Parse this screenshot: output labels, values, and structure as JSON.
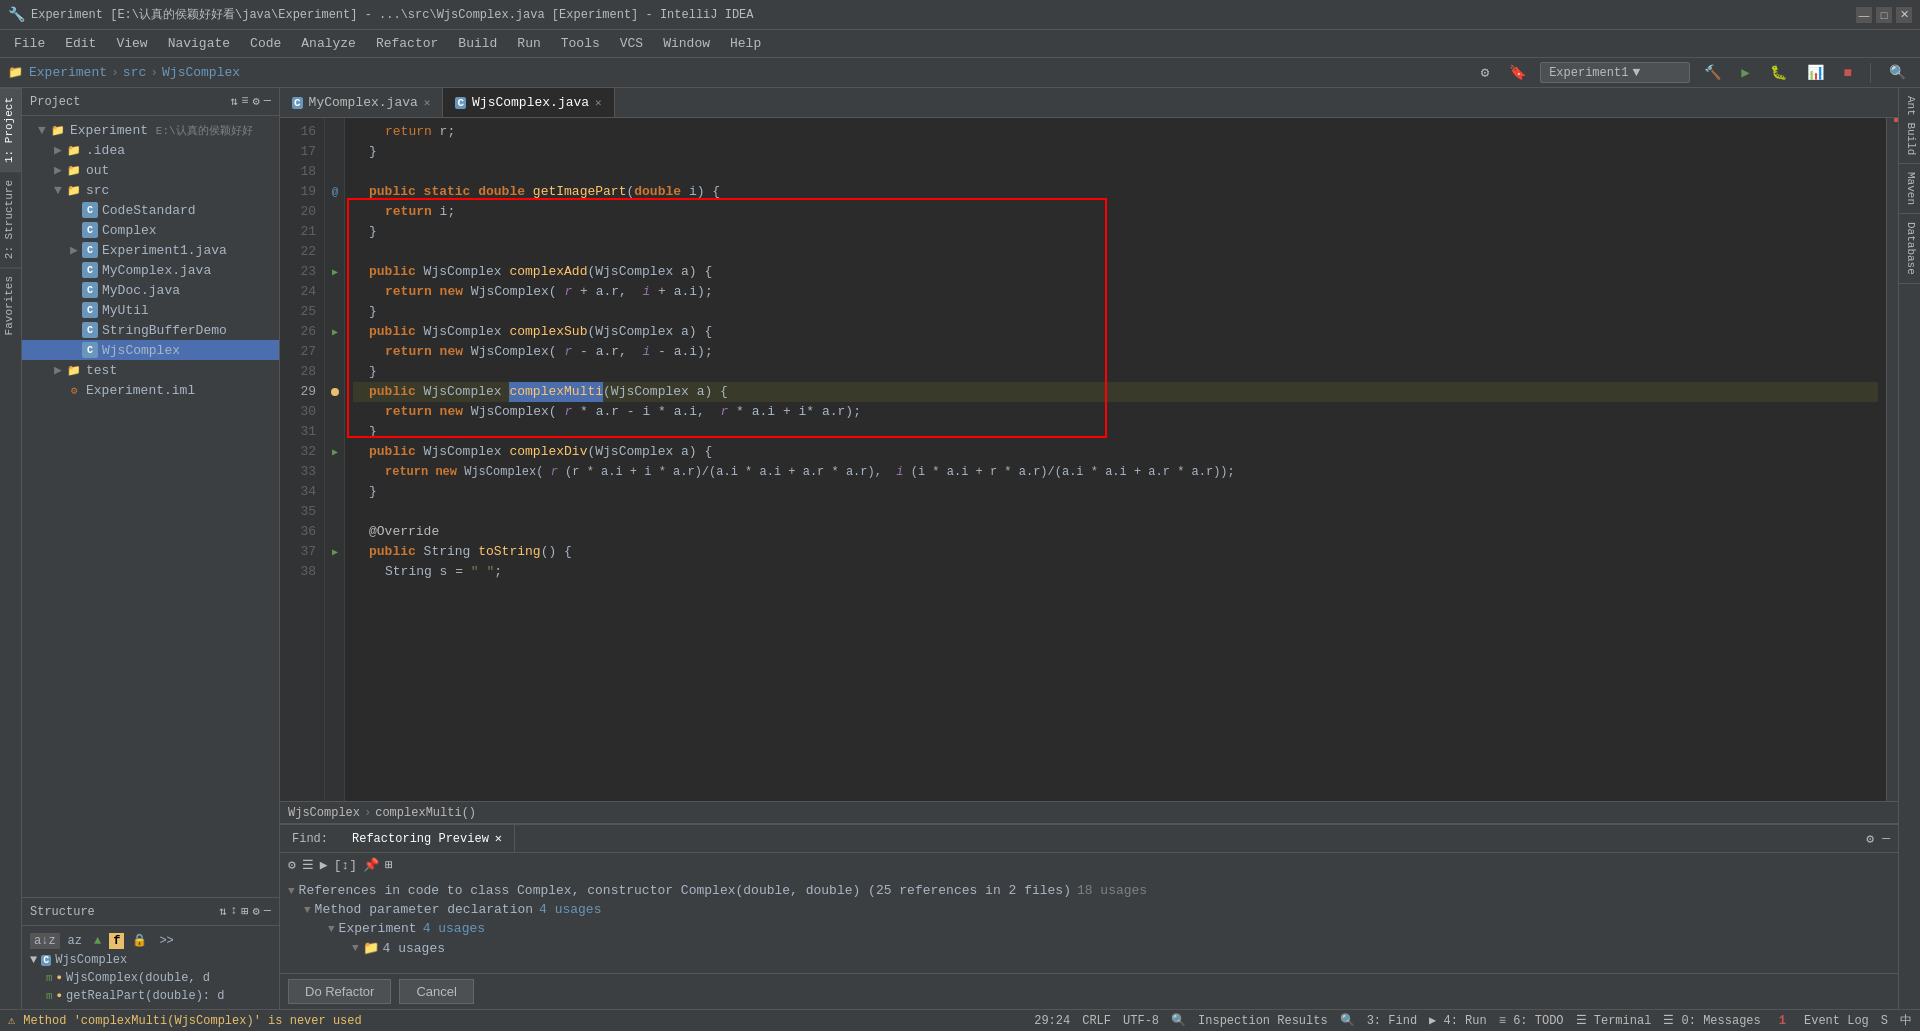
{
  "title_bar": {
    "text": "Experiment [E:\\认真的侯颖好好看\\java\\Experiment] - ...\\src\\WjsComplex.java [Experiment] - IntelliJ IDEA",
    "min_btn": "—",
    "max_btn": "□",
    "close_btn": "✕"
  },
  "menu": {
    "items": [
      "File",
      "Edit",
      "View",
      "Navigate",
      "Code",
      "Analyze",
      "Refactor",
      "Build",
      "Run",
      "Tools",
      "VCS",
      "Window",
      "Help"
    ]
  },
  "breadcrumb": {
    "items": [
      "Experiment",
      "src",
      "WjsComplex"
    ]
  },
  "tabs": {
    "items": [
      {
        "label": "MyComplex.java",
        "active": false,
        "icon": "C"
      },
      {
        "label": "WjsComplex.java",
        "active": true,
        "icon": "C"
      }
    ]
  },
  "project_panel": {
    "title": "Project",
    "root": "Experiment",
    "root_path": "E:\\认真的侯颖好好",
    "items": [
      {
        "indent": 1,
        "label": ".idea",
        "type": "folder",
        "arrow": "▶"
      },
      {
        "indent": 1,
        "label": "out",
        "type": "folder",
        "arrow": "▶"
      },
      {
        "indent": 1,
        "label": "src",
        "type": "folder",
        "arrow": "▼"
      },
      {
        "indent": 2,
        "label": "CodeStandard",
        "type": "java",
        "arrow": ""
      },
      {
        "indent": 2,
        "label": "Complex",
        "type": "java",
        "arrow": ""
      },
      {
        "indent": 2,
        "label": "Experiment1.java",
        "type": "java",
        "arrow": "▶"
      },
      {
        "indent": 2,
        "label": "MyComplex.java",
        "type": "java",
        "arrow": ""
      },
      {
        "indent": 2,
        "label": "MyDoc.java",
        "type": "java",
        "arrow": ""
      },
      {
        "indent": 2,
        "label": "MyUtil",
        "type": "java",
        "arrow": ""
      },
      {
        "indent": 2,
        "label": "StringBufferDemo",
        "type": "java",
        "arrow": ""
      },
      {
        "indent": 2,
        "label": "WjsComplex",
        "type": "java",
        "arrow": "",
        "selected": true
      },
      {
        "indent": 1,
        "label": "test",
        "type": "folder",
        "arrow": "▶"
      },
      {
        "indent": 1,
        "label": "Experiment.iml",
        "type": "iml",
        "arrow": ""
      }
    ]
  },
  "structure_panel": {
    "title": "Structure",
    "class": "WjsComplex",
    "items": [
      {
        "label": "WjsComplex(double, d",
        "type": "method"
      },
      {
        "label": "getRealPart(double): d",
        "type": "method"
      }
    ]
  },
  "code": {
    "lines": [
      {
        "num": 16,
        "content": "        return r;"
      },
      {
        "num": 17,
        "content": "    }"
      },
      {
        "num": 18,
        "content": ""
      },
      {
        "num": 19,
        "content": "    public static double getImagePart(double i) {",
        "annotation": "@"
      },
      {
        "num": 20,
        "content": "        return i;"
      },
      {
        "num": 21,
        "content": "    }"
      },
      {
        "num": 22,
        "content": ""
      },
      {
        "num": 23,
        "content": "    public WjsComplex complexAdd(WjsComplex a) {",
        "red": true
      },
      {
        "num": 24,
        "content": "        return new WjsComplex( r + a.r,  i + a.i);",
        "red": true
      },
      {
        "num": 25,
        "content": "    }",
        "red": true
      },
      {
        "num": 26,
        "content": "    public WjsComplex complexSub(WjsComplex a) {",
        "red": true
      },
      {
        "num": 27,
        "content": "        return new WjsComplex( r - a.r,  i - a.i);",
        "red": true
      },
      {
        "num": 28,
        "content": "    }",
        "red": true
      },
      {
        "num": 29,
        "content": "    public WjsComplex complexMulti(WjsComplex a) {",
        "red": true,
        "highlighted": true
      },
      {
        "num": 30,
        "content": "        return new WjsComplex( r * a.r - i * a.i,  r * a.i + i * a.r);",
        "red": true
      },
      {
        "num": 31,
        "content": "    }",
        "red": true
      },
      {
        "num": 32,
        "content": "    public WjsComplex complexDiv(WjsComplex a) {",
        "red": true
      },
      {
        "num": 33,
        "content": "        return new WjsComplex( (r * a.i + i * a.r)/(a.i * a.i + a.r * a.r),  (i * a.i + r * a.r)/(a.i * a.i + a.r * a.r));",
        "red": true
      },
      {
        "num": 34,
        "content": "    }",
        "red": true
      },
      {
        "num": 35,
        "content": ""
      },
      {
        "num": 36,
        "content": "    @Override"
      },
      {
        "num": 37,
        "content": "    public String toString() {"
      },
      {
        "num": 38,
        "content": "        String s = \" \";"
      }
    ]
  },
  "code_breadcrumb": {
    "items": [
      "WjsComplex",
      "complexMulti()"
    ]
  },
  "bottom_panel": {
    "find_label": "Find:",
    "tabs": [
      {
        "label": "Refactoring Preview",
        "active": true
      },
      {
        "label": "✕",
        "active": false
      }
    ],
    "main_ref": "References in code to class Complex, constructor Complex(double, double) (25 references in 2 files)",
    "usages_count": "18 usages",
    "sub_items": [
      {
        "label": "Method parameter declaration",
        "count": "4 usages"
      },
      {
        "label": "Experiment",
        "count": "4 usages"
      },
      {
        "label": "4 usages",
        "count": ""
      }
    ]
  },
  "action_buttons": {
    "do_refactor": "Do Refactor",
    "cancel": "Cancel"
  },
  "status_bar": {
    "warning": "Method 'complexMulti(WjsComplex)' is never used",
    "position": "29:24",
    "encoding": "CRLF",
    "indent": "UTF-8"
  },
  "toolbar": {
    "run_config": "Experiment1",
    "buttons": [
      "run",
      "debug",
      "stop",
      "build",
      "search"
    ]
  },
  "right_tabs": [
    "Ant Build",
    "Maven",
    "Database"
  ],
  "left_tabs": [
    "1: Project",
    "2: Structure",
    "Favorites"
  ]
}
